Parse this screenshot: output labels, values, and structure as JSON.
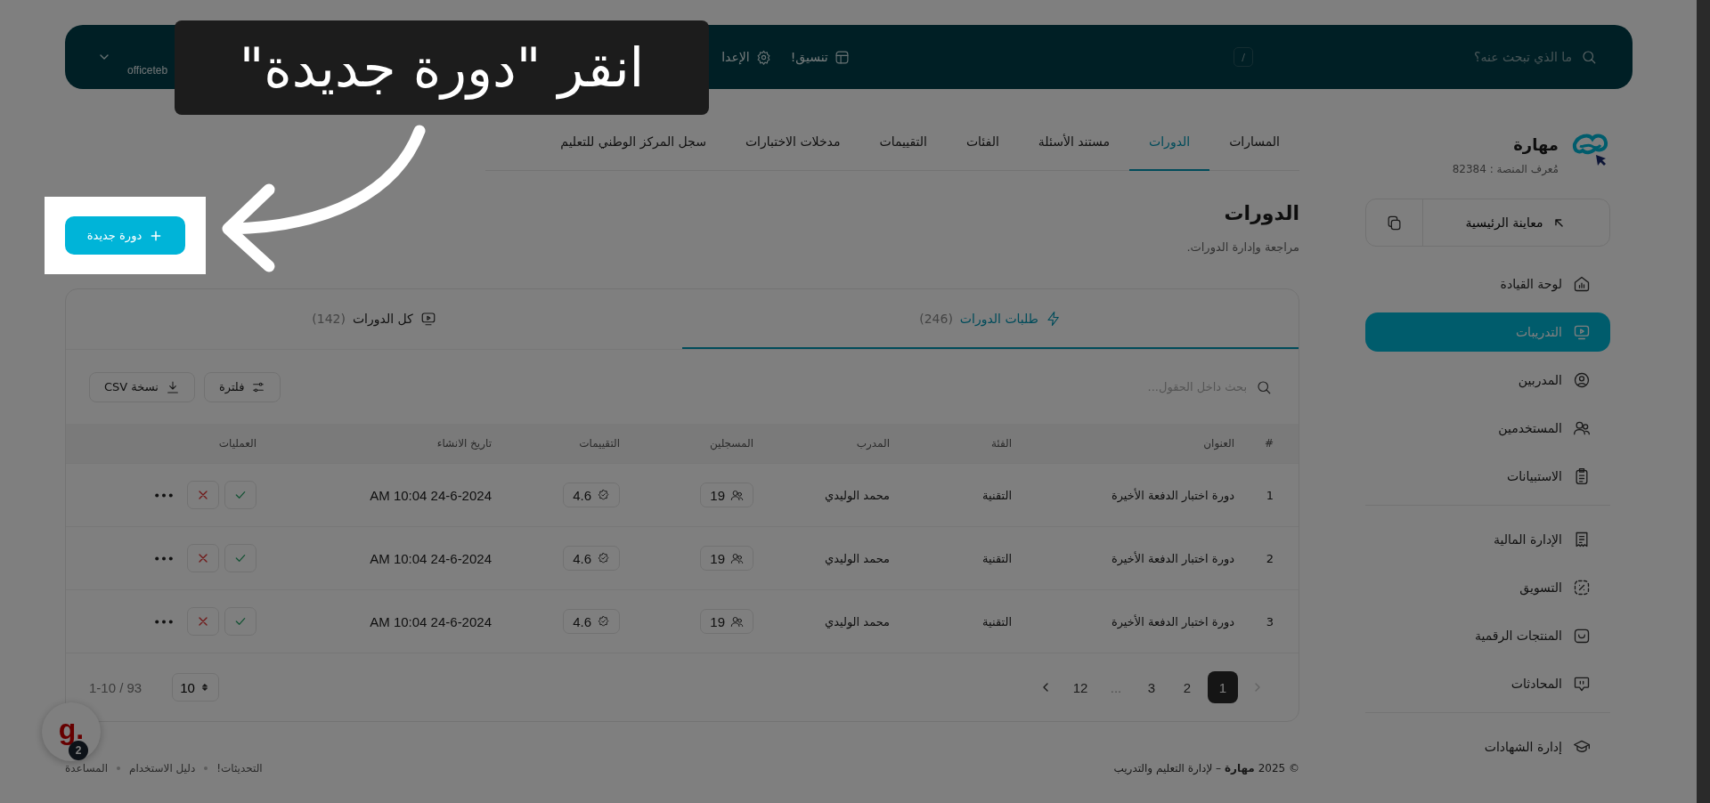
{
  "topbar": {
    "search_placeholder": "ما الذي تبحث عنه؟",
    "shortcut": "/",
    "links": [
      {
        "label": "تنسيق!"
      },
      {
        "label": "الإعدا"
      }
    ],
    "user_email": "officeteb"
  },
  "brand": {
    "name": "مهارة",
    "platform_id": "مُعرف المنصة : 82384"
  },
  "preview_button": "معاينة الرئيسية",
  "sidebar": {
    "groups": [
      [
        {
          "label": "لوحة القيادة",
          "selected": false
        },
        {
          "label": "التدريبات",
          "selected": true
        },
        {
          "label": "المدربين",
          "selected": false
        },
        {
          "label": "المستخدمين",
          "selected": false
        },
        {
          "label": "الاستبيانات",
          "selected": false
        }
      ],
      [
        {
          "label": "الإدارة المالية",
          "selected": false
        },
        {
          "label": "التسويق",
          "selected": false
        },
        {
          "label": "المنتجات الرقمية",
          "selected": false
        },
        {
          "label": "المحادثات",
          "selected": false
        }
      ],
      [
        {
          "label": "إدارة الشهادات",
          "selected": false
        }
      ]
    ]
  },
  "nav_tabs": [
    {
      "label": "المسارات",
      "selected": false
    },
    {
      "label": "الدورات",
      "selected": true
    },
    {
      "label": "مستند الأسئلة",
      "selected": false
    },
    {
      "label": "الفئات",
      "selected": false
    },
    {
      "label": "التقييمات",
      "selected": false
    },
    {
      "label": "مدخلات الاختبارات",
      "selected": false
    },
    {
      "label": "سجل المركز الوطني للتعليم",
      "selected": false
    }
  ],
  "page": {
    "title": "الدورات",
    "subtitle": "مراجعة وإدارة الدورات.",
    "new_button": "دورة جديدة"
  },
  "card_tabs": [
    {
      "label": "طلبات الدورات",
      "count": "(246)",
      "selected": true
    },
    {
      "label": "كل الدورات",
      "count": "(142)",
      "selected": false
    }
  ],
  "table_search": {
    "placeholder": "بحث داخل الحقول..."
  },
  "toolbar_buttons": [
    "فلترة",
    "نسخة CSV"
  ],
  "table": {
    "columns": [
      "#",
      "العنوان",
      "الفئة",
      "المدرب",
      "المسجلين",
      "التقييمات",
      "تاريخ الانشاء",
      "العمليات"
    ],
    "rows": [
      {
        "cells": [
          "1",
          "دورة اختبار الدفعة الأخيرة",
          "التقنية",
          "محمد الوليدي",
          "19",
          "4.6",
          "AM 10:04 24-6-2024"
        ]
      },
      {
        "cells": [
          "2",
          "دورة اختبار الدفعة الأخيرة",
          "التقنية",
          "محمد الوليدي",
          "19",
          "4.6",
          "AM 10:04 24-6-2024"
        ]
      },
      {
        "cells": [
          "3",
          "دورة اختبار الدفعة الأخيرة",
          "التقنية",
          "محمد الوليدي",
          "19",
          "4.6",
          "AM 10:04 24-6-2024"
        ]
      }
    ]
  },
  "pagination": {
    "range": "1-10 / 93",
    "page_size": "10",
    "prev_disabled": true,
    "next_disabled": false,
    "pages": [
      {
        "label": "1",
        "kind": "page",
        "selected": true
      },
      {
        "label": "2",
        "kind": "page",
        "selected": false
      },
      {
        "label": "3",
        "kind": "page",
        "selected": false
      },
      {
        "label": "...",
        "kind": "ellipsis",
        "selected": false
      },
      {
        "label": "12",
        "kind": "page",
        "selected": false
      }
    ]
  },
  "footer": {
    "copyright": "© 2025 **مهارة** – لإدارة التعليم والتدريب",
    "links": [
      "التحديثات!",
      "دليل الاستخدام",
      "المساعدة"
    ]
  },
  "chat_widget": {
    "logo": "g.",
    "badge": "2"
  },
  "tour": {
    "hint": "انقر \"دورة جديدة\""
  }
}
